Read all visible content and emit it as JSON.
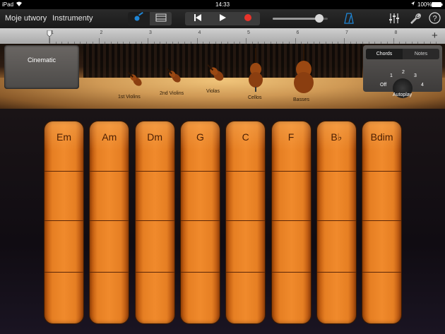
{
  "status": {
    "device": "iPad",
    "time": "14:33",
    "battery": "100%"
  },
  "toolbar": {
    "my_songs": "Moje utwory",
    "instruments": "Instrumenty",
    "play_icon": "play-icon",
    "record_icon": "record-icon",
    "rewind_icon": "rewind-icon",
    "volume": 0.85
  },
  "ruler": {
    "marks": [
      "1",
      "2",
      "3",
      "4",
      "5",
      "6",
      "7",
      "8"
    ]
  },
  "preset": {
    "name": "Cinematic"
  },
  "instruments": [
    {
      "label": "1st Violins"
    },
    {
      "label": "2nd Violins"
    },
    {
      "label": "Violas"
    },
    {
      "label": "Cellos"
    },
    {
      "label": "Basses"
    }
  ],
  "mode": {
    "chords": "Chords",
    "notes": "Notes",
    "selected": "Chords"
  },
  "autoplay": {
    "label": "Autoplay",
    "off": "Off",
    "positions": [
      "1",
      "2",
      "3",
      "4"
    ]
  },
  "chords": [
    "Em",
    "Am",
    "Dm",
    "G",
    "C",
    "F",
    "B♭",
    "Bdim"
  ],
  "colors": {
    "accent": "#e67f23",
    "record": "#e8332a",
    "metronome": "#1f86d6"
  }
}
